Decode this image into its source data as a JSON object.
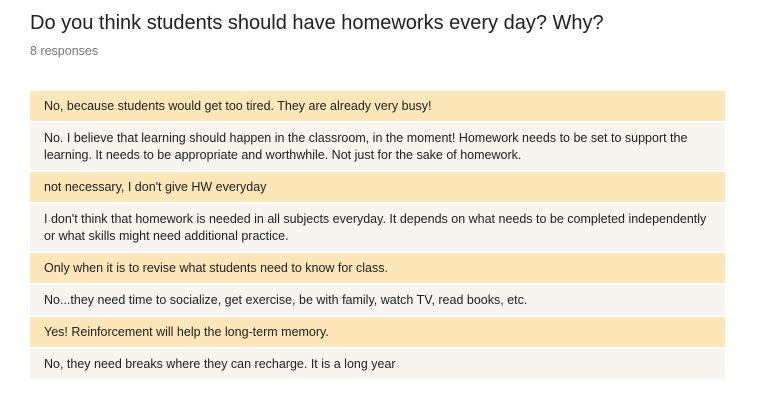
{
  "question": {
    "title": "Do you think students should have homeworks every day? Why?",
    "response_count": "8 responses"
  },
  "responses": [
    "No, because students would get too tired. They are already very busy!",
    "No. I believe that learning should happen in the classroom, in the moment! Homework needs to be set to support the learning. It needs to be appropriate and worthwhile. Not just for the sake of homework.",
    "not necessary, I don't give HW everyday",
    "I don't think that homework is needed in all subjects everyday. It depends on what needs to be completed independently or what skills might need additional practice.",
    "Only when it is to revise what students need to know for class.",
    "No...they need time to socialize, get exercise, be with family, watch TV, read books, etc.",
    "Yes! Reinforcement will help the long-term memory.",
    "No, they need breaks where they can recharge. It is a long year"
  ],
  "colors": {
    "odd_row": "#fde7b8",
    "even_row": "#f8f4f0",
    "title_text": "#212121",
    "count_text": "#757575"
  }
}
